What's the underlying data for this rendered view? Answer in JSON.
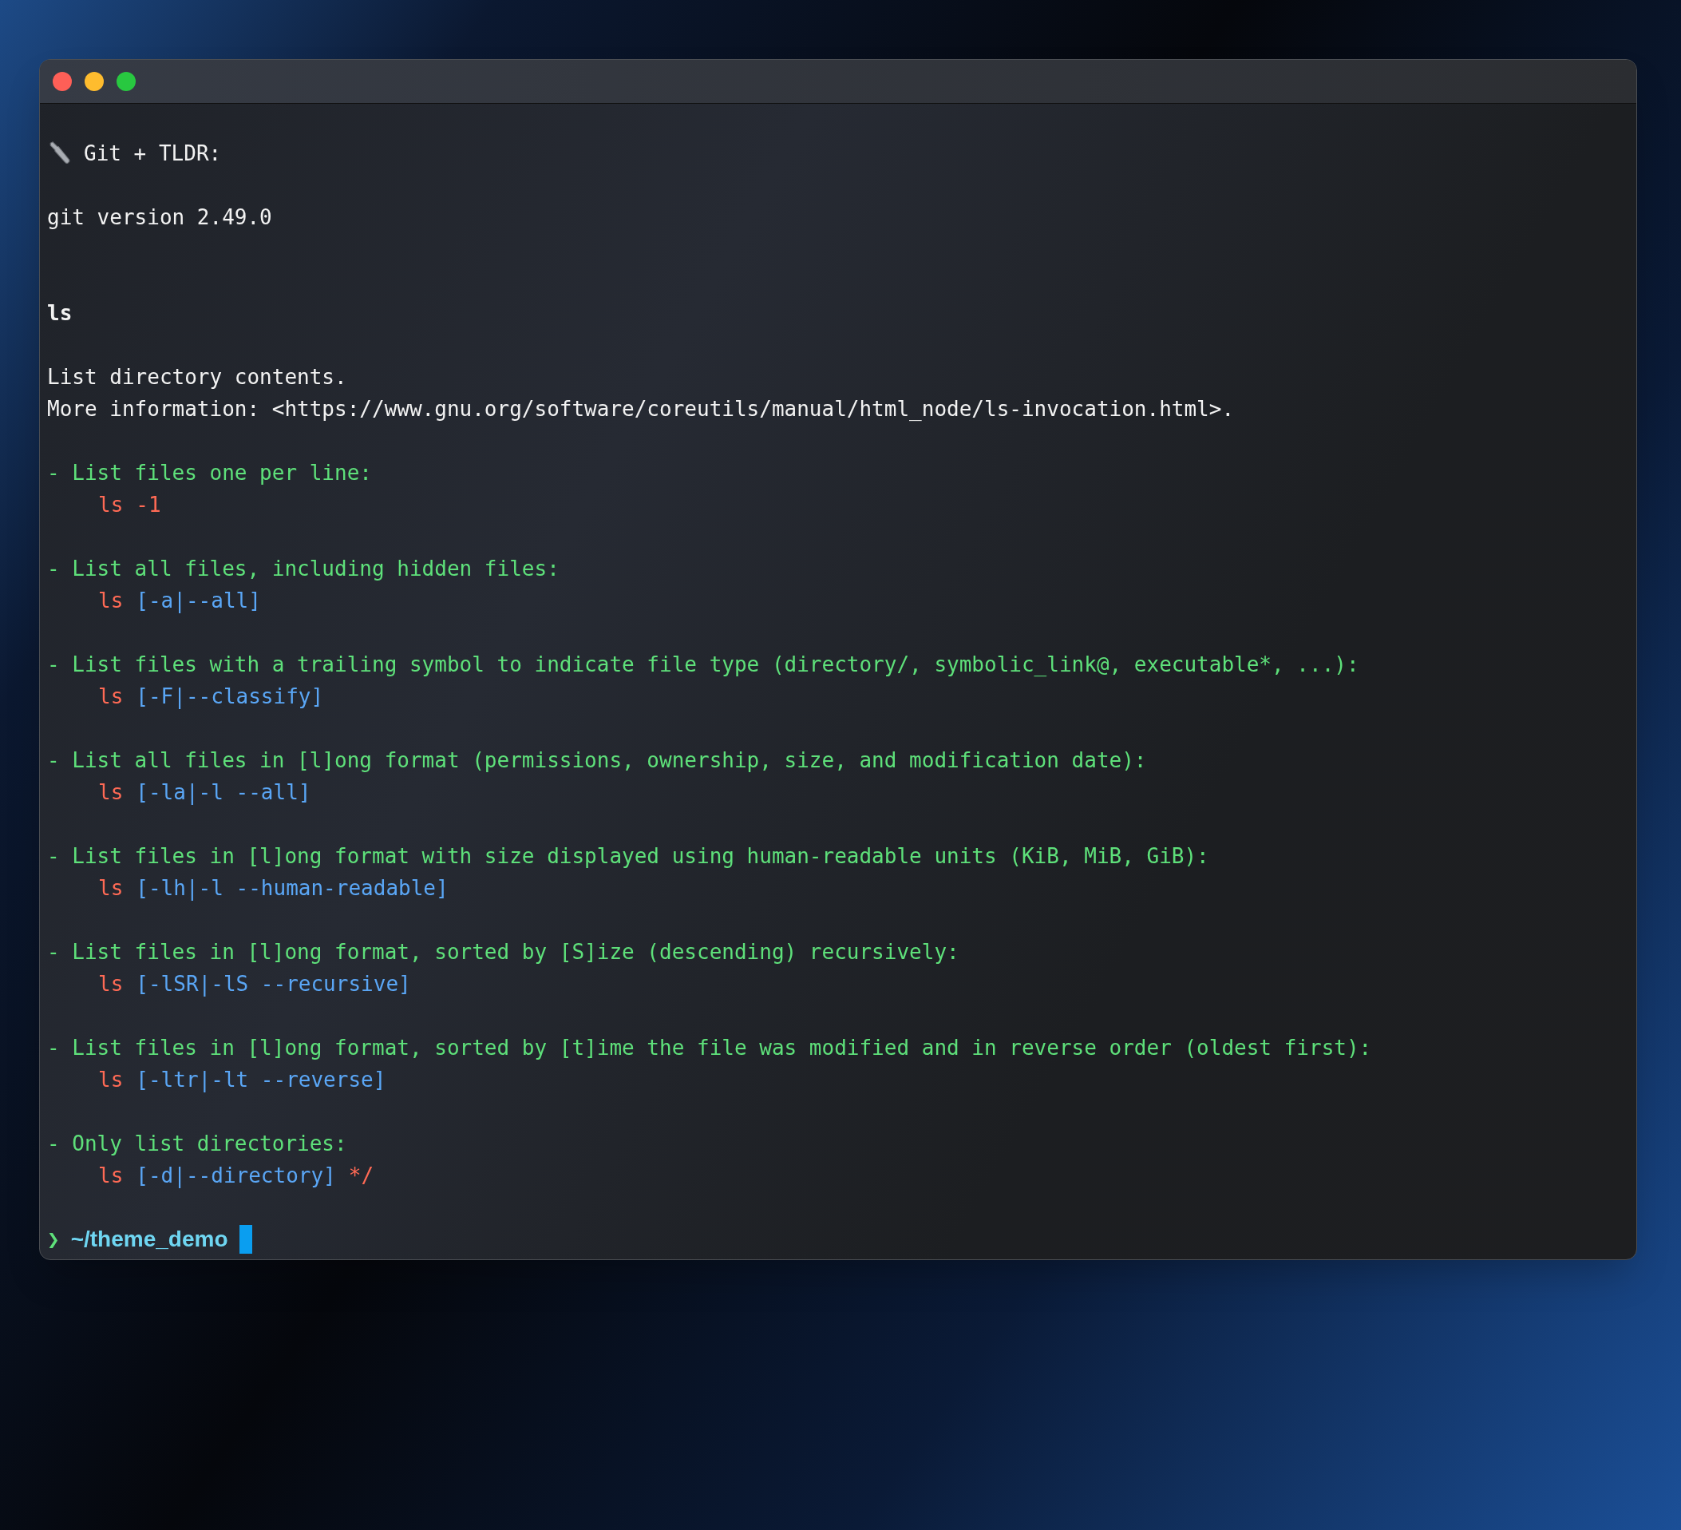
{
  "window": {
    "controls": [
      {
        "kind": "close"
      },
      {
        "kind": "minimize"
      },
      {
        "kind": "zoom"
      }
    ]
  },
  "terminal": {
    "heading": "Git + TLDR:",
    "version": "git version 2.49.0",
    "page_title": "ls",
    "description": "List directory contents.",
    "more_info": "More information: <https://www.gnu.org/software/coreutils/manual/html_node/ls-invocation.html>.",
    "examples": [
      {
        "description": "- List files one per line:",
        "command": [
          {
            "kind": "cmd",
            "text": "ls"
          },
          {
            "kind": "cmd",
            "text": "-1"
          }
        ]
      },
      {
        "description": "- List all files, including hidden files:",
        "command": [
          {
            "kind": "cmd",
            "text": "ls"
          },
          {
            "kind": "arg",
            "text": "[-a|--all]"
          }
        ]
      },
      {
        "description": "- List files with a trailing symbol to indicate file type (directory/, symbolic_link@, executable*, ...):",
        "command": [
          {
            "kind": "cmd",
            "text": "ls"
          },
          {
            "kind": "arg",
            "text": "[-F|--classify]"
          }
        ]
      },
      {
        "description": "- List all files in [l]ong format (permissions, ownership, size, and modification date):",
        "command": [
          {
            "kind": "cmd",
            "text": "ls"
          },
          {
            "kind": "arg",
            "text": "[-la|-l --all]"
          }
        ]
      },
      {
        "description": "- List files in [l]ong format with size displayed using human-readable units (KiB, MiB, GiB):",
        "command": [
          {
            "kind": "cmd",
            "text": "ls"
          },
          {
            "kind": "arg",
            "text": "[-lh|-l --human-readable]"
          }
        ]
      },
      {
        "description": "- List files in [l]ong format, sorted by [S]ize (descending) recursively:",
        "command": [
          {
            "kind": "cmd",
            "text": "ls"
          },
          {
            "kind": "arg",
            "text": "[-lSR|-lS --recursive]"
          }
        ]
      },
      {
        "description": "- List files in [l]ong format, sorted by [t]ime the file was modified and in reverse order (oldest first):",
        "command": [
          {
            "kind": "cmd",
            "text": "ls"
          },
          {
            "kind": "arg",
            "text": "[-ltr|-lt --reverse]"
          }
        ]
      },
      {
        "description": "- Only list directories:",
        "command": [
          {
            "kind": "cmd",
            "text": "ls"
          },
          {
            "kind": "arg",
            "text": "[-d|--directory]"
          },
          {
            "kind": "cmd",
            "text": "*/"
          }
        ]
      }
    ],
    "prompt": {
      "symbol": "❯",
      "path": "~/theme_demo"
    }
  }
}
